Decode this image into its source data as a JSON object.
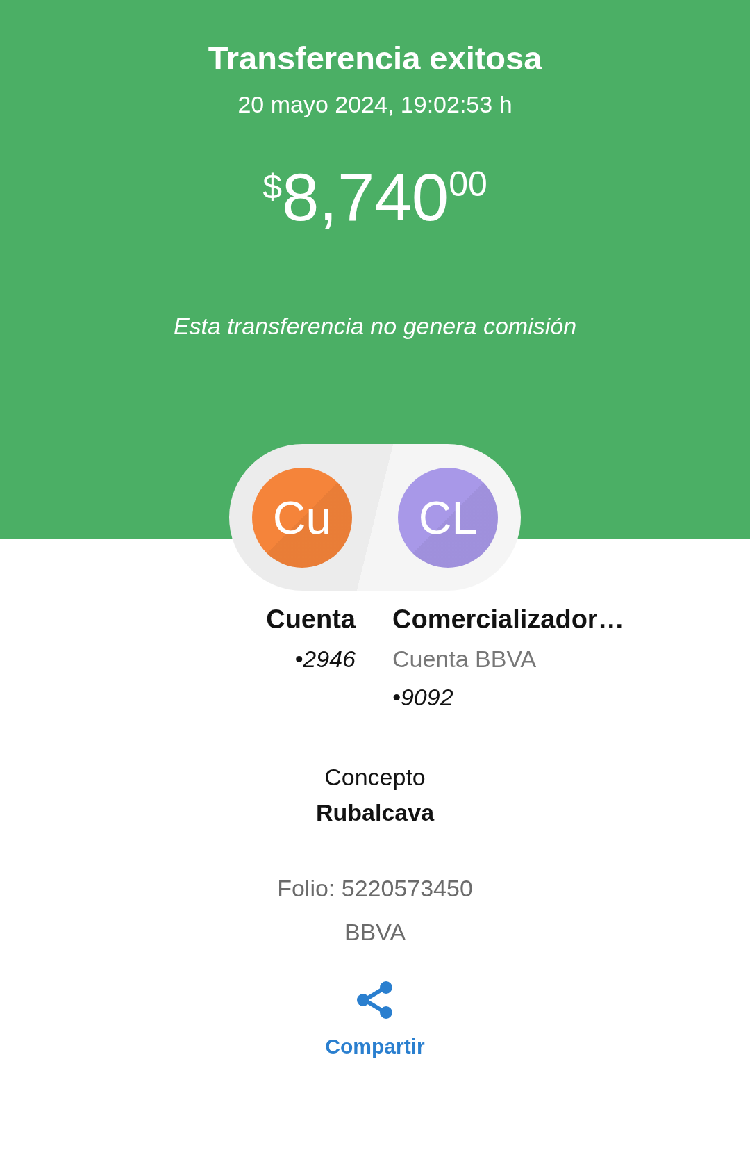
{
  "header": {
    "title": "Transferencia exitosa",
    "timestamp": "20 mayo 2024, 19:02:53 h",
    "amount": {
      "currency": "$",
      "integer": "8,740",
      "cents": "00"
    },
    "note": "Esta transferencia no genera comisión"
  },
  "parties": [
    {
      "initials": "Cu",
      "color": "#f5843a",
      "name": "Cuenta",
      "account": "•2946"
    },
    {
      "initials": "CL",
      "color": "#a898e8",
      "name": "Comercializador…",
      "bank_account": "Cuenta BBVA",
      "account": "•9092"
    }
  ],
  "concept": {
    "label": "Concepto",
    "value": "Rubalcava"
  },
  "folio": "Folio: 5220573450",
  "bank": "BBVA",
  "share": {
    "label": "Compartir"
  }
}
